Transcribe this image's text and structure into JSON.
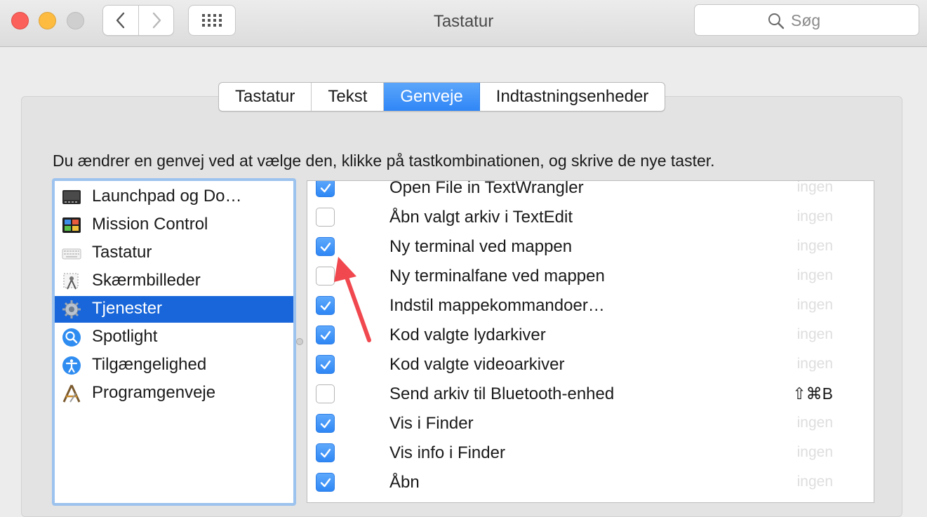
{
  "window": {
    "title": "Tastatur",
    "search_placeholder": "Søg"
  },
  "tabs": [
    {
      "label": "Tastatur",
      "active": false
    },
    {
      "label": "Tekst",
      "active": false
    },
    {
      "label": "Genveje",
      "active": true
    },
    {
      "label": "Indtastningsenheder",
      "active": false
    }
  ],
  "instruction": "Du ændrer en genvej ved at vælge den, klikke på tastkombinationen, og skrive de nye taster.",
  "categories": [
    {
      "label": "Launchpad og Do…",
      "icon": "launchpad-icon"
    },
    {
      "label": "Mission Control",
      "icon": "mission-control-icon"
    },
    {
      "label": "Tastatur",
      "icon": "keyboard-icon"
    },
    {
      "label": "Skærmbilleder",
      "icon": "screenshot-icon"
    },
    {
      "label": "Tjenester",
      "icon": "gear-icon",
      "selected": true
    },
    {
      "label": "Spotlight",
      "icon": "spotlight-icon"
    },
    {
      "label": "Tilgængelighed",
      "icon": "accessibility-icon"
    },
    {
      "label": "Programgenveje",
      "icon": "app-shortcuts-icon"
    }
  ],
  "services": [
    {
      "label": "Open File in TextWrangler",
      "checked": true,
      "shortcut": "ingen"
    },
    {
      "label": "Åbn valgt arkiv i TextEdit",
      "checked": false,
      "shortcut": "ingen"
    },
    {
      "label": "Ny terminal ved mappen",
      "checked": true,
      "shortcut": "ingen"
    },
    {
      "label": "Ny terminalfane ved mappen",
      "checked": false,
      "shortcut": "ingen"
    },
    {
      "label": "Indstil mappekommandoer…",
      "checked": true,
      "shortcut": "ingen"
    },
    {
      "label": "Kod valgte lydarkiver",
      "checked": true,
      "shortcut": "ingen"
    },
    {
      "label": "Kod valgte videoarkiver",
      "checked": true,
      "shortcut": "ingen"
    },
    {
      "label": "Send arkiv til Bluetooth-enhed",
      "checked": false,
      "shortcut": "⇧⌘B"
    },
    {
      "label": "Vis i Finder",
      "checked": true,
      "shortcut": "ingen"
    },
    {
      "label": "Vis info i Finder",
      "checked": true,
      "shortcut": "ingen"
    },
    {
      "label": "Åbn",
      "checked": true,
      "shortcut": "ingen"
    }
  ],
  "colors": {
    "accent": "#2f86f6",
    "selection": "#1866d9",
    "annotation_arrow": "#f0484e"
  }
}
